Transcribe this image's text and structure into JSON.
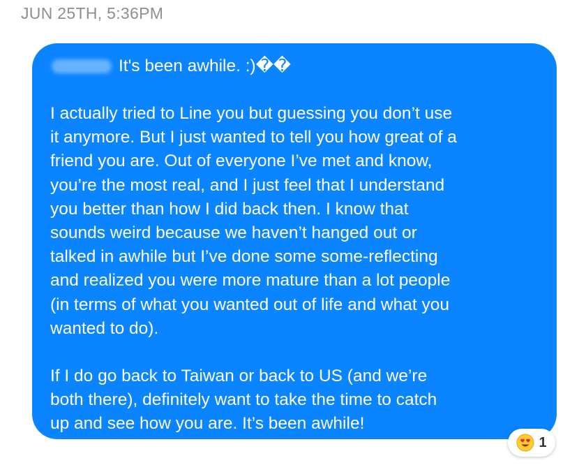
{
  "message": {
    "timestamp": "JUN 25TH, 5:36PM",
    "greeting": "It's been awhile. :)��",
    "paragraph_1": "I actually tried to Line you but guessing you don’t use\nit anymore. But I just wanted to tell you how great of a\nfriend you are. Out of everyone I’ve met and know,\nyou’re the most real, and I just feel that I understand\nyou better than how I did back then. I know that\nsounds weird because we haven’t hanged out or\ntalked in awhile but I’ve done some some-reflecting\nand realized you were more mature than a lot people\n(in terms of what you wanted out of life and what you\nwanted to do).",
    "paragraph_2": "If I do go back to Taiwan or back to US (and we’re\nboth there), definitely want to take the time to catch\nup and see how you are. It’s been awhile!",
    "bubble_color": "#0b84ff"
  },
  "reaction": {
    "icon": "heart-eyes-icon",
    "count": "1"
  }
}
